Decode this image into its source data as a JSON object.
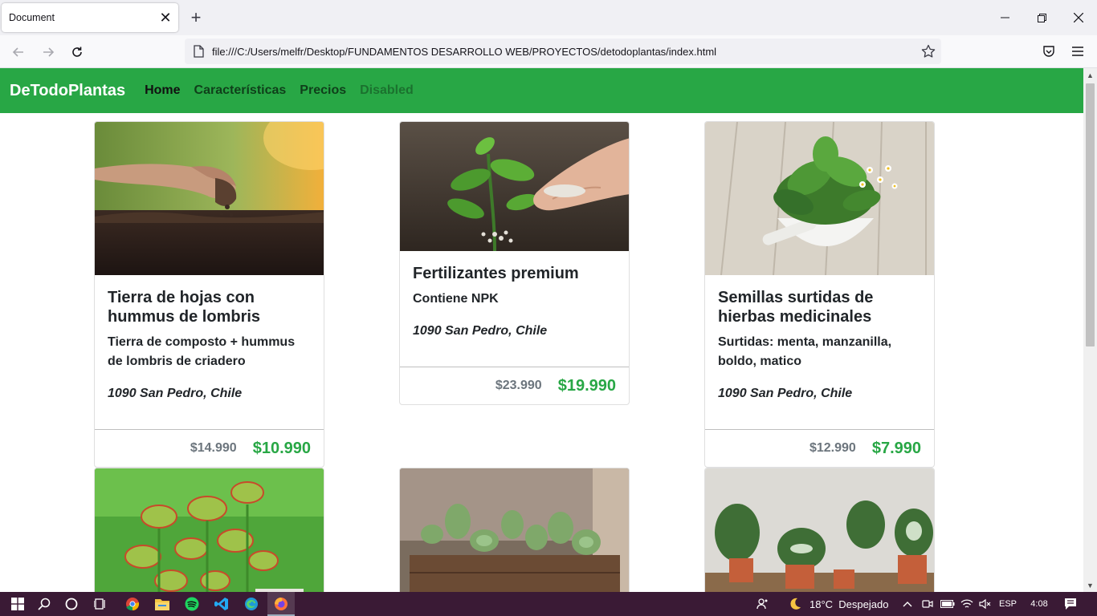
{
  "browser": {
    "tab_title": "Document",
    "url": "file:///C:/Users/melfr/Desktop/FUNDAMENTOS DESARROLLO WEB/PROYECTOS/detodoplantas/index.html"
  },
  "site": {
    "brand": "DeTodoPlantas",
    "nav": {
      "home": "Home",
      "features": "Características",
      "pricing": "Precios",
      "disabled": "Disabled"
    },
    "products": [
      {
        "title": "Tierra de hojas con hummus de lombris",
        "description": "Tierra de composto + hummus de lombris de criadero",
        "location": "1090 San Pedro, Chile",
        "old_price": "$14.990",
        "price": "$10.990"
      },
      {
        "title": "Fertilizantes premium",
        "description": "Contiene NPK",
        "location": "1090 San Pedro, Chile",
        "old_price": "$23.990",
        "price": "$19.990"
      },
      {
        "title": "Semillas surtidas de hierbas medicinales",
        "description": "Surtidas: menta, manzanilla, boldo, matico",
        "location": "1090 San Pedro, Chile",
        "old_price": "$12.990",
        "price": "$7.990"
      }
    ]
  },
  "taskbar": {
    "weather": "18°C  Despejado",
    "language": "ESP",
    "time": "4:08"
  },
  "colors": {
    "brand_green": "#28a745",
    "taskbar": "#3a1a35"
  }
}
